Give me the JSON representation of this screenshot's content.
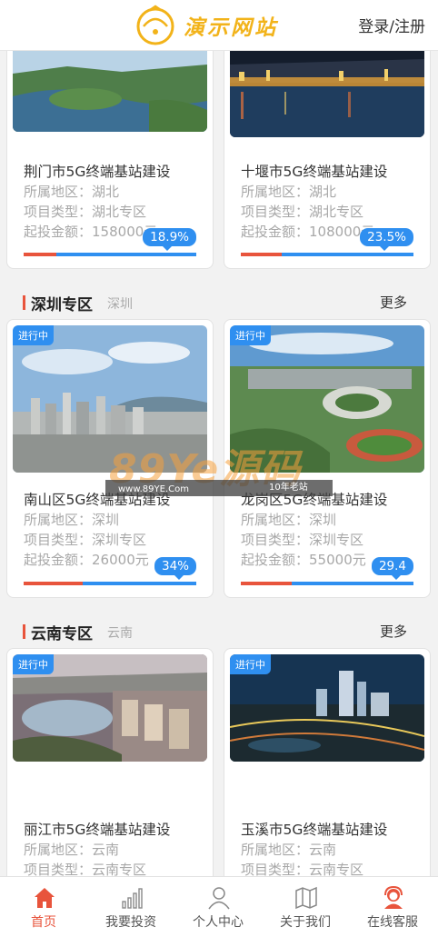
{
  "header": {
    "logo_text": "演示网站",
    "login_label": "登录/注册"
  },
  "field_labels": {
    "region": "所属地区：",
    "type": "项目类型：",
    "amount": "起投金额："
  },
  "cards_top": [
    {
      "title": "荆门市5G终端基站建设",
      "region": "湖北",
      "type": "湖北专区",
      "amount": "158000元",
      "percent_label": "18.9%",
      "progress": 0.189
    },
    {
      "title": "十堰市5G终端基站建设",
      "region": "湖北",
      "type": "湖北专区",
      "amount": "108000元",
      "percent_label": "23.5%",
      "progress": 0.235
    }
  ],
  "sections": [
    {
      "name": "深圳专区",
      "sub": "深圳",
      "more": "更多",
      "cards": [
        {
          "tag": "进行中",
          "title": "南山区5G终端基站建设",
          "region": "深圳",
          "type": "深圳专区",
          "amount": "26000元",
          "percent_label": "34%",
          "progress": 0.34
        },
        {
          "tag": "进行中",
          "title": "龙岗区5G终端基站建设",
          "region": "深圳",
          "type": "深圳专区",
          "amount": "55000元",
          "percent_label": "29.4",
          "progress": 0.294
        }
      ]
    },
    {
      "name": "云南专区",
      "sub": "云南",
      "more": "更多",
      "cards": [
        {
          "tag": "进行中",
          "title": "丽江市5G终端基站建设",
          "region": "云南",
          "type": "云南专区"
        },
        {
          "tag": "进行中",
          "title": "玉溪市5G终端基站建设",
          "region": "云南",
          "type": "云南专区"
        }
      ]
    }
  ],
  "watermark": {
    "big": "89Ye源码",
    "url": "www.89YE.Com",
    "note": "10年老站"
  },
  "tabbar": [
    {
      "label": "首页",
      "icon": "home-icon",
      "active": true
    },
    {
      "label": "我要投资",
      "icon": "bar-chart-icon",
      "active": false
    },
    {
      "label": "个人中心",
      "icon": "user-icon",
      "active": false
    },
    {
      "label": "关于我们",
      "icon": "map-book-icon",
      "active": false
    },
    {
      "label": "在线客服",
      "icon": "customer-service-icon",
      "active": false
    }
  ],
  "colors": {
    "accent": "#e8543c",
    "progress_blue": "#2f8ff0",
    "logo_gold": "#f2b31a"
  }
}
